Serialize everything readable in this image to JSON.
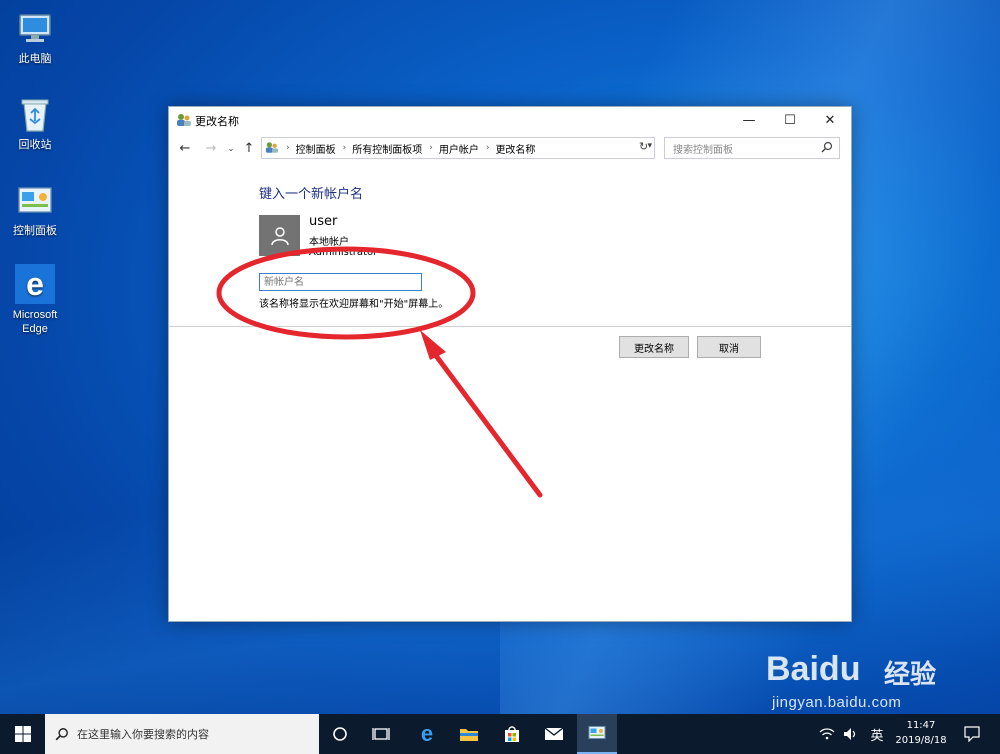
{
  "desktop": {
    "icons": [
      {
        "name": "this-pc",
        "label": "此电脑"
      },
      {
        "name": "recycle-bin",
        "label": "回收站"
      },
      {
        "name": "control-panel",
        "label": "控制面板"
      },
      {
        "name": "microsoft-edge",
        "label": "Microsoft\nEdge"
      }
    ]
  },
  "window": {
    "title": "更改名称",
    "controls": {
      "minimize": "—",
      "maximize": "☐",
      "close": "✕"
    },
    "address": {
      "crumbs": [
        "控制面板",
        "所有控制面板项",
        "用户帐户",
        "更改名称"
      ],
      "separator": "›"
    },
    "search_placeholder": "搜索控制面板",
    "heading": "键入一个新帐户名",
    "account": {
      "name": "user",
      "type": "本地帐户",
      "role": "Administrator"
    },
    "new_name_placeholder": "新帐户名",
    "new_name_value": "",
    "hint": "该名称将显示在欢迎屏幕和\"开始\"屏幕上。",
    "buttons": {
      "change_name": "更改名称",
      "cancel": "取消"
    }
  },
  "taskbar": {
    "search_placeholder": "在这里输入你要搜索的内容",
    "ime": "英",
    "time": "11:47",
    "date": "2019/8/18"
  },
  "watermark": {
    "logo_part1": "Bai",
    "logo_part2": "du",
    "logo_suffix": "经验",
    "url": "jingyan.baidu.com"
  },
  "colors": {
    "heading": "#1e3287",
    "annotation": "#e3272d",
    "focus_border": "#3a7fd0",
    "taskbar": "#0c1a2e"
  }
}
